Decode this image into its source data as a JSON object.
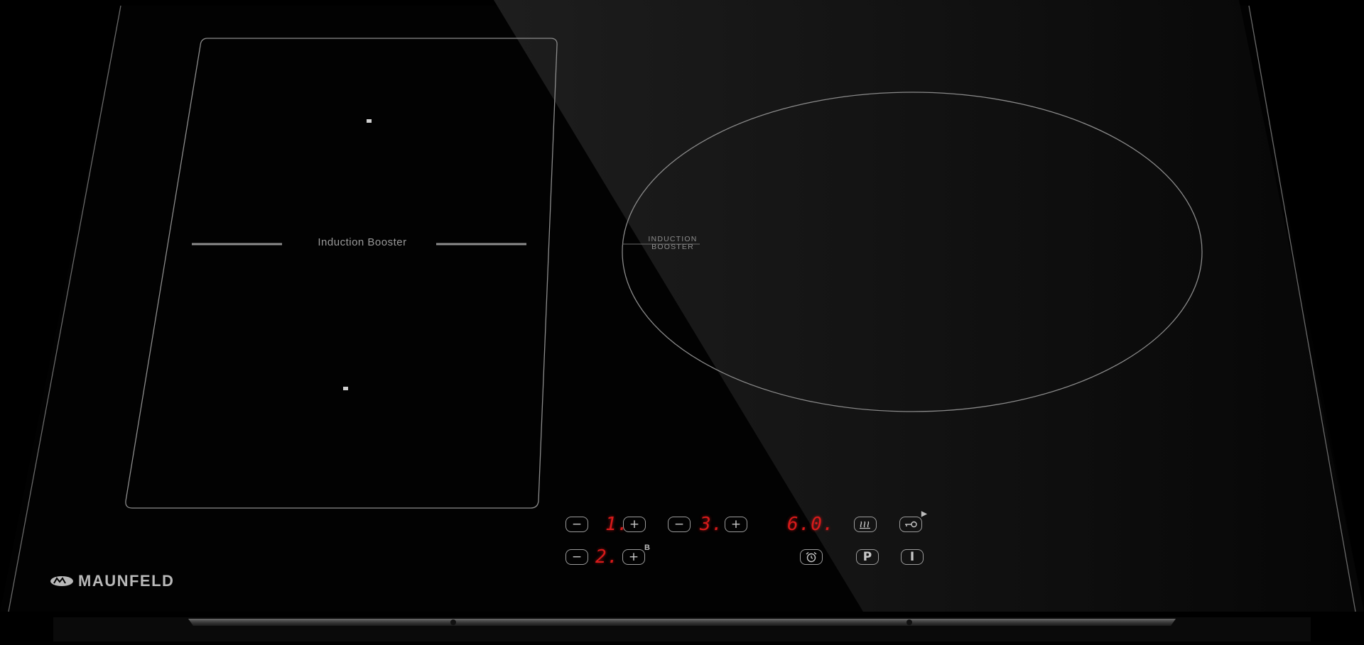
{
  "brand": {
    "name": "MAUNFELD"
  },
  "zones": {
    "left_label": "Induction Booster",
    "right_label_line1": "INDUCTION",
    "right_label_line2": "BOOSTER"
  },
  "controls": {
    "zone1": {
      "minus": "−",
      "display": "1.",
      "plus": "+"
    },
    "zone2": {
      "minus": "−",
      "display": "2.",
      "plus": "+",
      "boost_mark": "B"
    },
    "zone3": {
      "minus": "−",
      "display": "3.",
      "plus": "+"
    },
    "timer_display": "6.0.",
    "buttons": {
      "keep_warm_icon": "keep-warm-icon",
      "lock_icon": "key-lock-icon",
      "timer_icon": "alarm-clock-icon",
      "pause": "P",
      "power": "I"
    },
    "lock_indicator": "▶"
  },
  "colors": {
    "glass": "#000000",
    "line": "#8a8a8a",
    "display_red": "#d81a1a",
    "logo": "#b9b9b9"
  }
}
